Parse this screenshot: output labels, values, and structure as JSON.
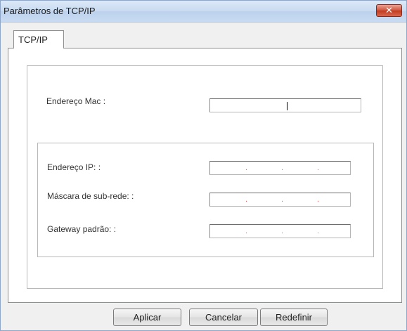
{
  "window": {
    "title": "Parâmetros de TCP/IP",
    "close_glyph": "✕"
  },
  "tabs": [
    {
      "label": "TCP/IP",
      "selected": true
    }
  ],
  "mac": {
    "label": "Endereço Mac :",
    "value": ""
  },
  "ip_group": {
    "fields": [
      {
        "label": "Endereço IP: :",
        "value": [
          "",
          "",
          "",
          ""
        ]
      },
      {
        "label": "Máscara de sub-rede: :",
        "value": [
          "",
          "",
          "",
          ""
        ]
      },
      {
        "label": "Gateway padrão: :",
        "value": [
          "",
          "",
          "",
          ""
        ]
      }
    ],
    "octet_separator": "."
  },
  "buttons": {
    "apply": "Aplicar",
    "cancel": "Cancelar",
    "reset": "Redefinir"
  },
  "colors": {
    "title_bar": "#c9dbf1",
    "close_button": "#c23a1f",
    "ip_dot": "#d46a6a"
  },
  "icons": {
    "close": "close-icon"
  }
}
